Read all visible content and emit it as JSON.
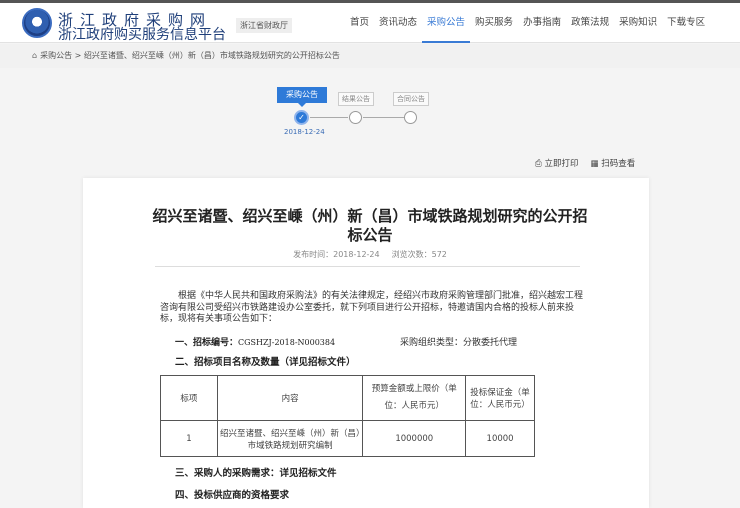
{
  "header": {
    "site_title": "浙江政府采购网",
    "site_subtitle": "浙江政府购买服务信息平台",
    "dept": "浙江省财政厅"
  },
  "nav": [
    "首页",
    "资讯动态",
    "采购公告",
    "购买服务",
    "办事指南",
    "政策法规",
    "采购知识",
    "下载专区"
  ],
  "breadcrumb": {
    "root": "采购公告",
    "sep": ">",
    "current": "绍兴至诸暨、绍兴至嵊（州）新（昌）市域铁路规划研究的公开招标公告"
  },
  "steps": [
    {
      "label": "采购公告",
      "date": "2018-12-24",
      "done": true
    },
    {
      "label": "结果公告"
    },
    {
      "label": "合同公告"
    }
  ],
  "actions": {
    "print": "立即打印",
    "scan": "扫码查看"
  },
  "article": {
    "title": "绍兴至诸暨、绍兴至嵊（州）新（昌）市域铁路规划研究的公开招标公告",
    "publish": "发布时间：2018-12-24",
    "views": "浏览次数：572",
    "intro": "根据《中华人民共和国政府采购法》的有关法律规定，经绍兴市政府采购管理部门批准，绍兴越宏工程咨询有限公司受绍兴市铁路建设办公室委托，就下列项目进行公开招标，特邀请国内合格的投标人前来投标，现将有关事项公告如下：",
    "s1_label": "一、招标编号：",
    "s1_value": "CGSHZJ-2018-N000384",
    "org_type": "采购组织类型：分散委托代理",
    "s2": "二、招标项目名称及数量（详见招标文件）",
    "table": {
      "headers": [
        "标项",
        "内容",
        "预算金额或上限价（单位：人民币元）",
        "投标保证金（单位：人民币元）"
      ],
      "rows": [
        [
          "1",
          "绍兴至诸暨、绍兴至嵊（州）新（昌）市域铁路规划研究编制",
          "1000000",
          "10000"
        ]
      ]
    },
    "s3": "三、采购人的采购需求：详见招标文件",
    "s4": "四、投标供应商的资格要求"
  }
}
